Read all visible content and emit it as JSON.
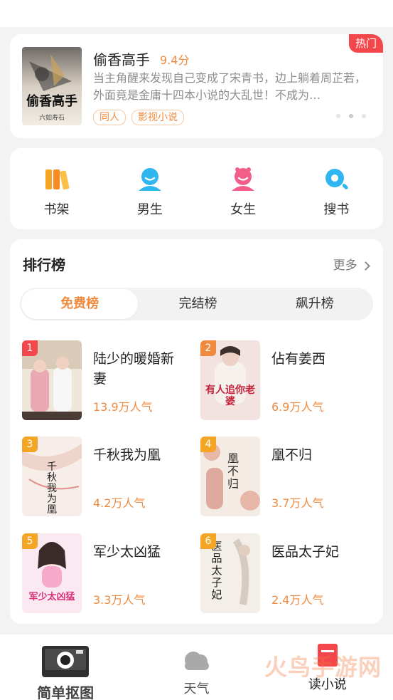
{
  "featured": {
    "hot_badge": "热门",
    "title": "偷香高手",
    "score": "9.4分",
    "description": "当主角醒来发现自己变成了宋青书，边上躺着周芷若，外面竟是金庸十四本小说的大乱世！不成为…",
    "tags": [
      "同人",
      "影视小说"
    ],
    "cover_text": "偷香高手",
    "cover_author": "六如寿石"
  },
  "quick_nav": [
    {
      "label": "书架",
      "icon": "bookshelf-icon",
      "color": "#f5a524"
    },
    {
      "label": "男生",
      "icon": "male-icon",
      "color": "#2fb6f0"
    },
    {
      "label": "女生",
      "icon": "female-icon",
      "color": "#f35d8a"
    },
    {
      "label": "搜书",
      "icon": "search-icon",
      "color": "#2fb6f0"
    }
  ],
  "ranking": {
    "heading": "排行榜",
    "more": "更多",
    "tabs": [
      "免费榜",
      "完结榜",
      "飙升榜"
    ],
    "active_tab": "免费榜",
    "books": [
      {
        "rank": "1",
        "name": "陆少的暖婚新妻",
        "popularity": "13.9万人气",
        "badge_color": "#f3474b"
      },
      {
        "rank": "2",
        "name": "佔有姜西",
        "popularity": "6.9万人气",
        "badge_color": "#f08a3e"
      },
      {
        "rank": "3",
        "name": "千秋我为凰",
        "popularity": "4.2万人气",
        "badge_color": "#f5a524"
      },
      {
        "rank": "4",
        "name": "凰不归",
        "popularity": "3.7万人气",
        "badge_color": "#f5a524"
      },
      {
        "rank": "5",
        "name": "军少太凶猛",
        "popularity": "3.3万人气",
        "badge_color": "#f5a524"
      },
      {
        "rank": "6",
        "name": "医品太子妃",
        "popularity": "2.4万人气",
        "badge_color": "#f5a524"
      }
    ],
    "cover_texts": {
      "b2": "有人追你老婆",
      "b3": "千秋我为凰",
      "b4": "凰不归",
      "b5": "军少太凶猛",
      "b6": "医品太子妃"
    }
  },
  "bottom_nav": [
    {
      "label": "简单抠图",
      "icon": "camera-icon"
    },
    {
      "label": "天气",
      "icon": "cloud-icon"
    },
    {
      "label": "读小说",
      "icon": "book-icon"
    }
  ],
  "watermark": "火鸟手游网",
  "colors": {
    "accent": "#f08a3e",
    "hot": "#f3474b",
    "background": "#f3f3f3"
  }
}
